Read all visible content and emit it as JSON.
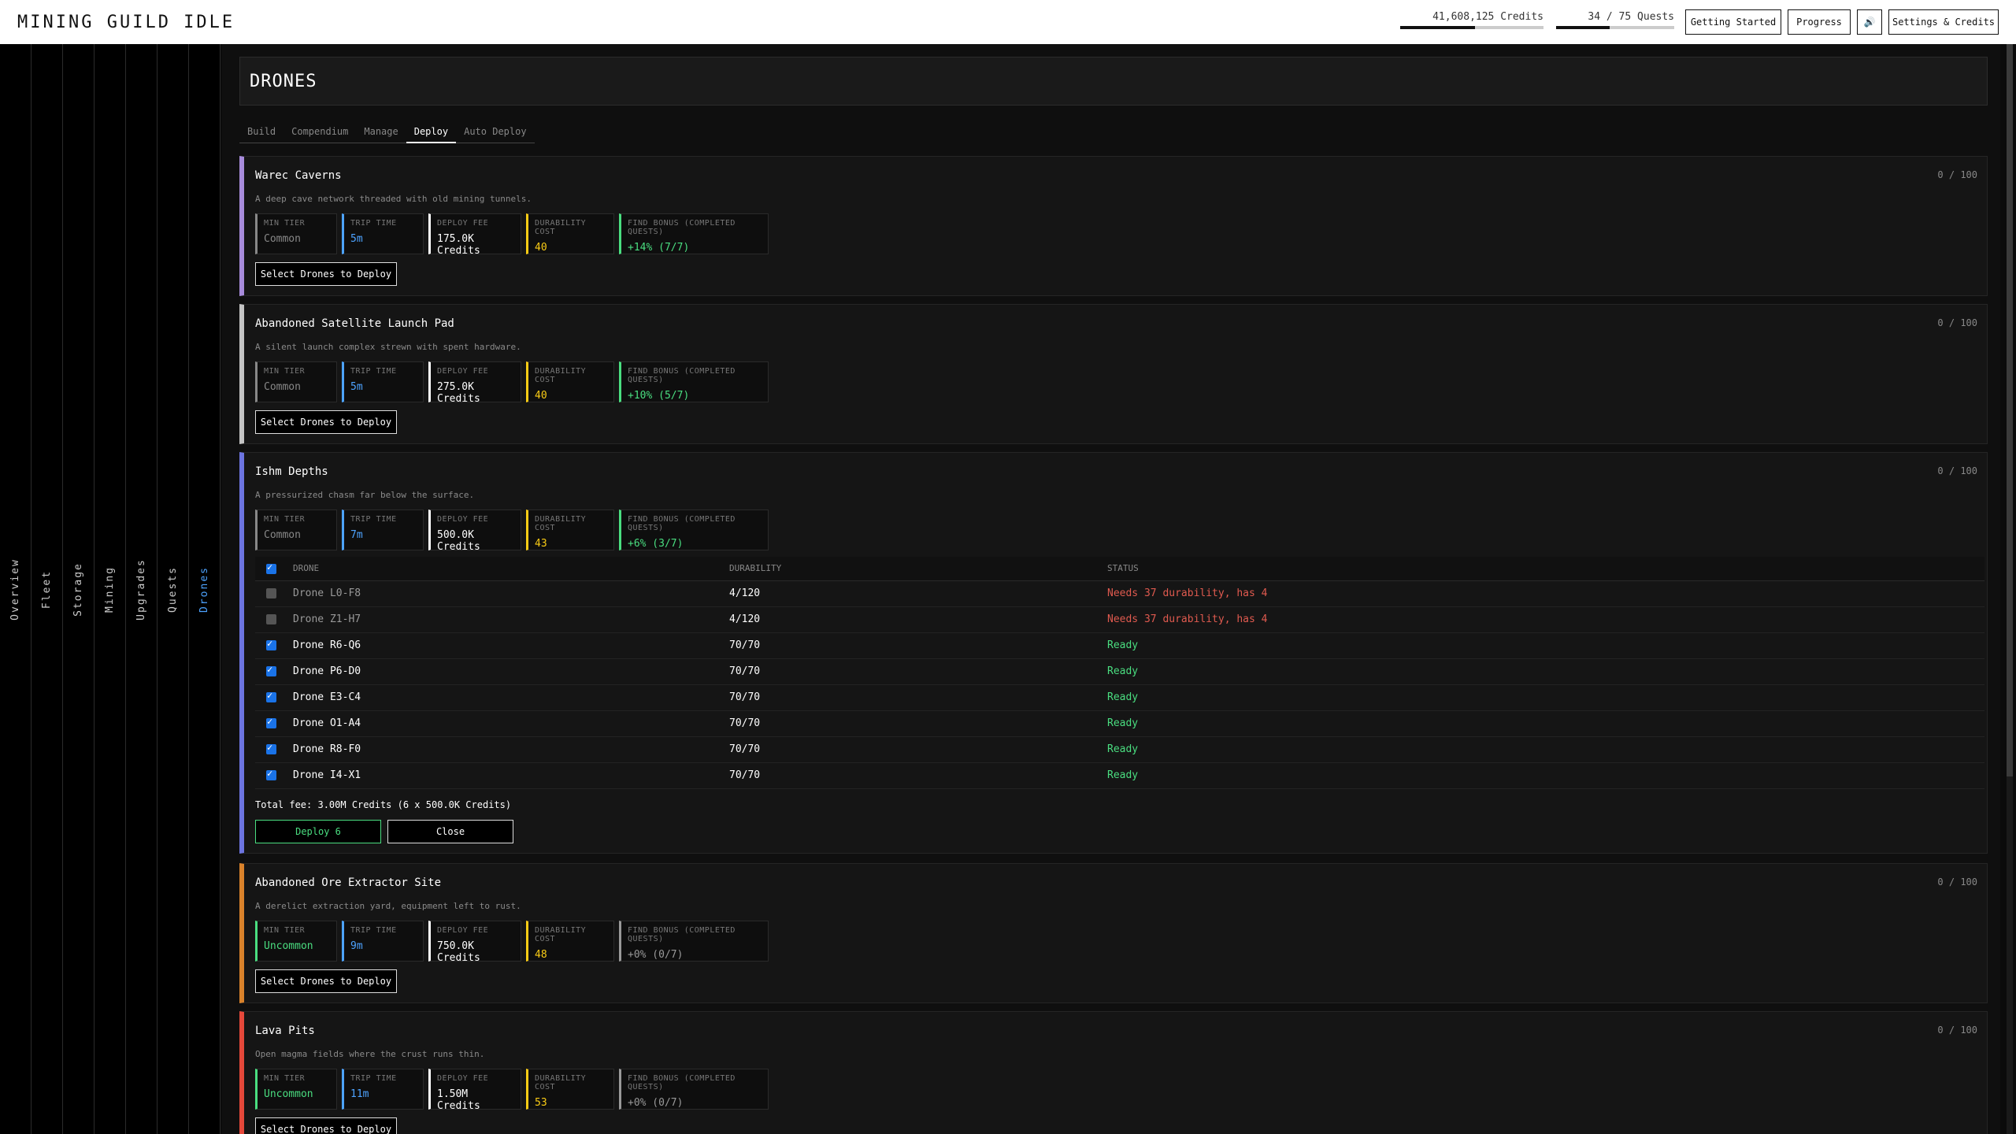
{
  "app_title": "MINING GUILD IDLE",
  "header": {
    "credits": "41,608,125 Credits",
    "credits_progress": 0.52,
    "quests": "34 / 75 Quests",
    "quests_progress": 0.45,
    "buttons": {
      "getting_started": "Getting Started",
      "progress": "Progress",
      "sound": "🔊",
      "settings": "Settings & Credits"
    }
  },
  "sidebar": [
    "Overview",
    "Fleet",
    "Storage",
    "Mining",
    "Upgrades",
    "Quests",
    "Drones"
  ],
  "page_title": "DRONES",
  "tabs": [
    "Build",
    "Compendium",
    "Manage",
    "Deploy",
    "Auto Deploy"
  ],
  "stat_labels": {
    "tier": "MIN TIER",
    "trip": "TRIP TIME",
    "fee": "DEPLOY FEE",
    "dur": "DURABILITY COST",
    "bonus": "FIND BONUS (COMPLETED QUESTS)"
  },
  "select_label": "Select Drones to Deploy",
  "colors": {
    "tier_common": "#888888",
    "tier_uncommon": "#4ade80",
    "trip": "#4da3ff",
    "durability": "#facc15",
    "bonus_active": "#4ade80",
    "bonus_inactive": "#999999"
  },
  "locations": [
    {
      "name": "Warec Caverns",
      "count": "0 / 100",
      "desc": "A deep cave network threaded with old mining tunnels.",
      "tier": "Common",
      "trip": "5m",
      "fee": "175.0K Credits",
      "dur": "40",
      "bonus": "+14% (7/7)",
      "accent": "#a78bdb",
      "tier_color": "#888888",
      "bonus_color": "#4ade80"
    },
    {
      "name": "Abandoned Satellite Launch Pad",
      "count": "0 / 100",
      "desc": "A silent launch complex strewn with spent hardware.",
      "tier": "Common",
      "trip": "5m",
      "fee": "275.0K Credits",
      "dur": "40",
      "bonus": "+10% (5/7)",
      "accent": "#c4c4c4",
      "tier_color": "#888888",
      "bonus_color": "#4ade80"
    },
    {
      "name": "Ishm Depths",
      "count": "0 / 100",
      "desc": "A pressurized chasm far below the surface.",
      "tier": "Common",
      "trip": "7m",
      "fee": "500.0K Credits",
      "dur": "43",
      "bonus": "+6% (3/7)",
      "accent": "#6c74e0",
      "tier_color": "#888888",
      "bonus_color": "#4ade80"
    },
    {
      "name": "Abandoned Ore Extractor Site",
      "count": "0 / 100",
      "desc": "A derelict extraction yard, equipment left to rust.",
      "tier": "Uncommon",
      "trip": "9m",
      "fee": "750.0K Credits",
      "dur": "48",
      "bonus": "+0% (0/7)",
      "accent": "#d9822b",
      "tier_color": "#4ade80",
      "bonus_color": "#999999"
    },
    {
      "name": "Lava Pits",
      "count": "0 / 100",
      "desc": "Open magma fields where the crust runs thin.",
      "tier": "Uncommon",
      "trip": "11m",
      "fee": "1.50M Credits",
      "dur": "53",
      "bonus": "+0% (0/7)",
      "accent": "#e5483a",
      "tier_color": "#4ade80",
      "bonus_color": "#999999"
    }
  ],
  "drone_table": {
    "headers": [
      "DRONE",
      "DURABILITY",
      "STATUS"
    ],
    "rows": [
      {
        "name": "Drone L0-F8",
        "durability": "4/120",
        "status": "Needs 37 durability, has 4",
        "checked": false
      },
      {
        "name": "Drone Z1-H7",
        "durability": "4/120",
        "status": "Needs 37 durability, has 4",
        "checked": false
      },
      {
        "name": "Drone R6-Q6",
        "durability": "70/70",
        "status": "Ready",
        "checked": true
      },
      {
        "name": "Drone P6-D0",
        "durability": "70/70",
        "status": "Ready",
        "checked": true
      },
      {
        "name": "Drone E3-C4",
        "durability": "70/70",
        "status": "Ready",
        "checked": true
      },
      {
        "name": "Drone O1-A4",
        "durability": "70/70",
        "status": "Ready",
        "checked": true
      },
      {
        "name": "Drone R8-F0",
        "durability": "70/70",
        "status": "Ready",
        "checked": true
      },
      {
        "name": "Drone I4-X1",
        "durability": "70/70",
        "status": "Ready",
        "checked": true
      }
    ],
    "total_fees": "Total fee: 3.00M Credits (6 x 500.0K Credits)",
    "deploy_label": "Deploy 6",
    "close_label": "Close"
  }
}
